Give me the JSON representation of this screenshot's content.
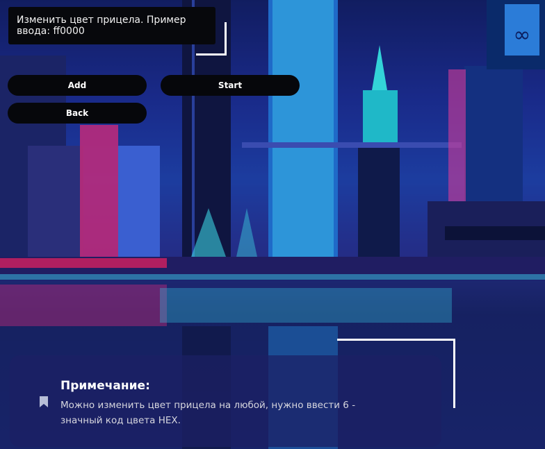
{
  "prompt": {
    "text": "Изменить цвет прицела. Пример ввода: ff0000"
  },
  "buttons": {
    "add": "Add",
    "start": "Start",
    "back": "Back"
  },
  "note": {
    "title": "Примечание:",
    "text": "Можно изменить цвет прицела на любой, нужно ввести 6 - значный код цвета HEX."
  },
  "colors": {
    "accent_white": "#ffffff",
    "panel_black": "#07080c"
  }
}
